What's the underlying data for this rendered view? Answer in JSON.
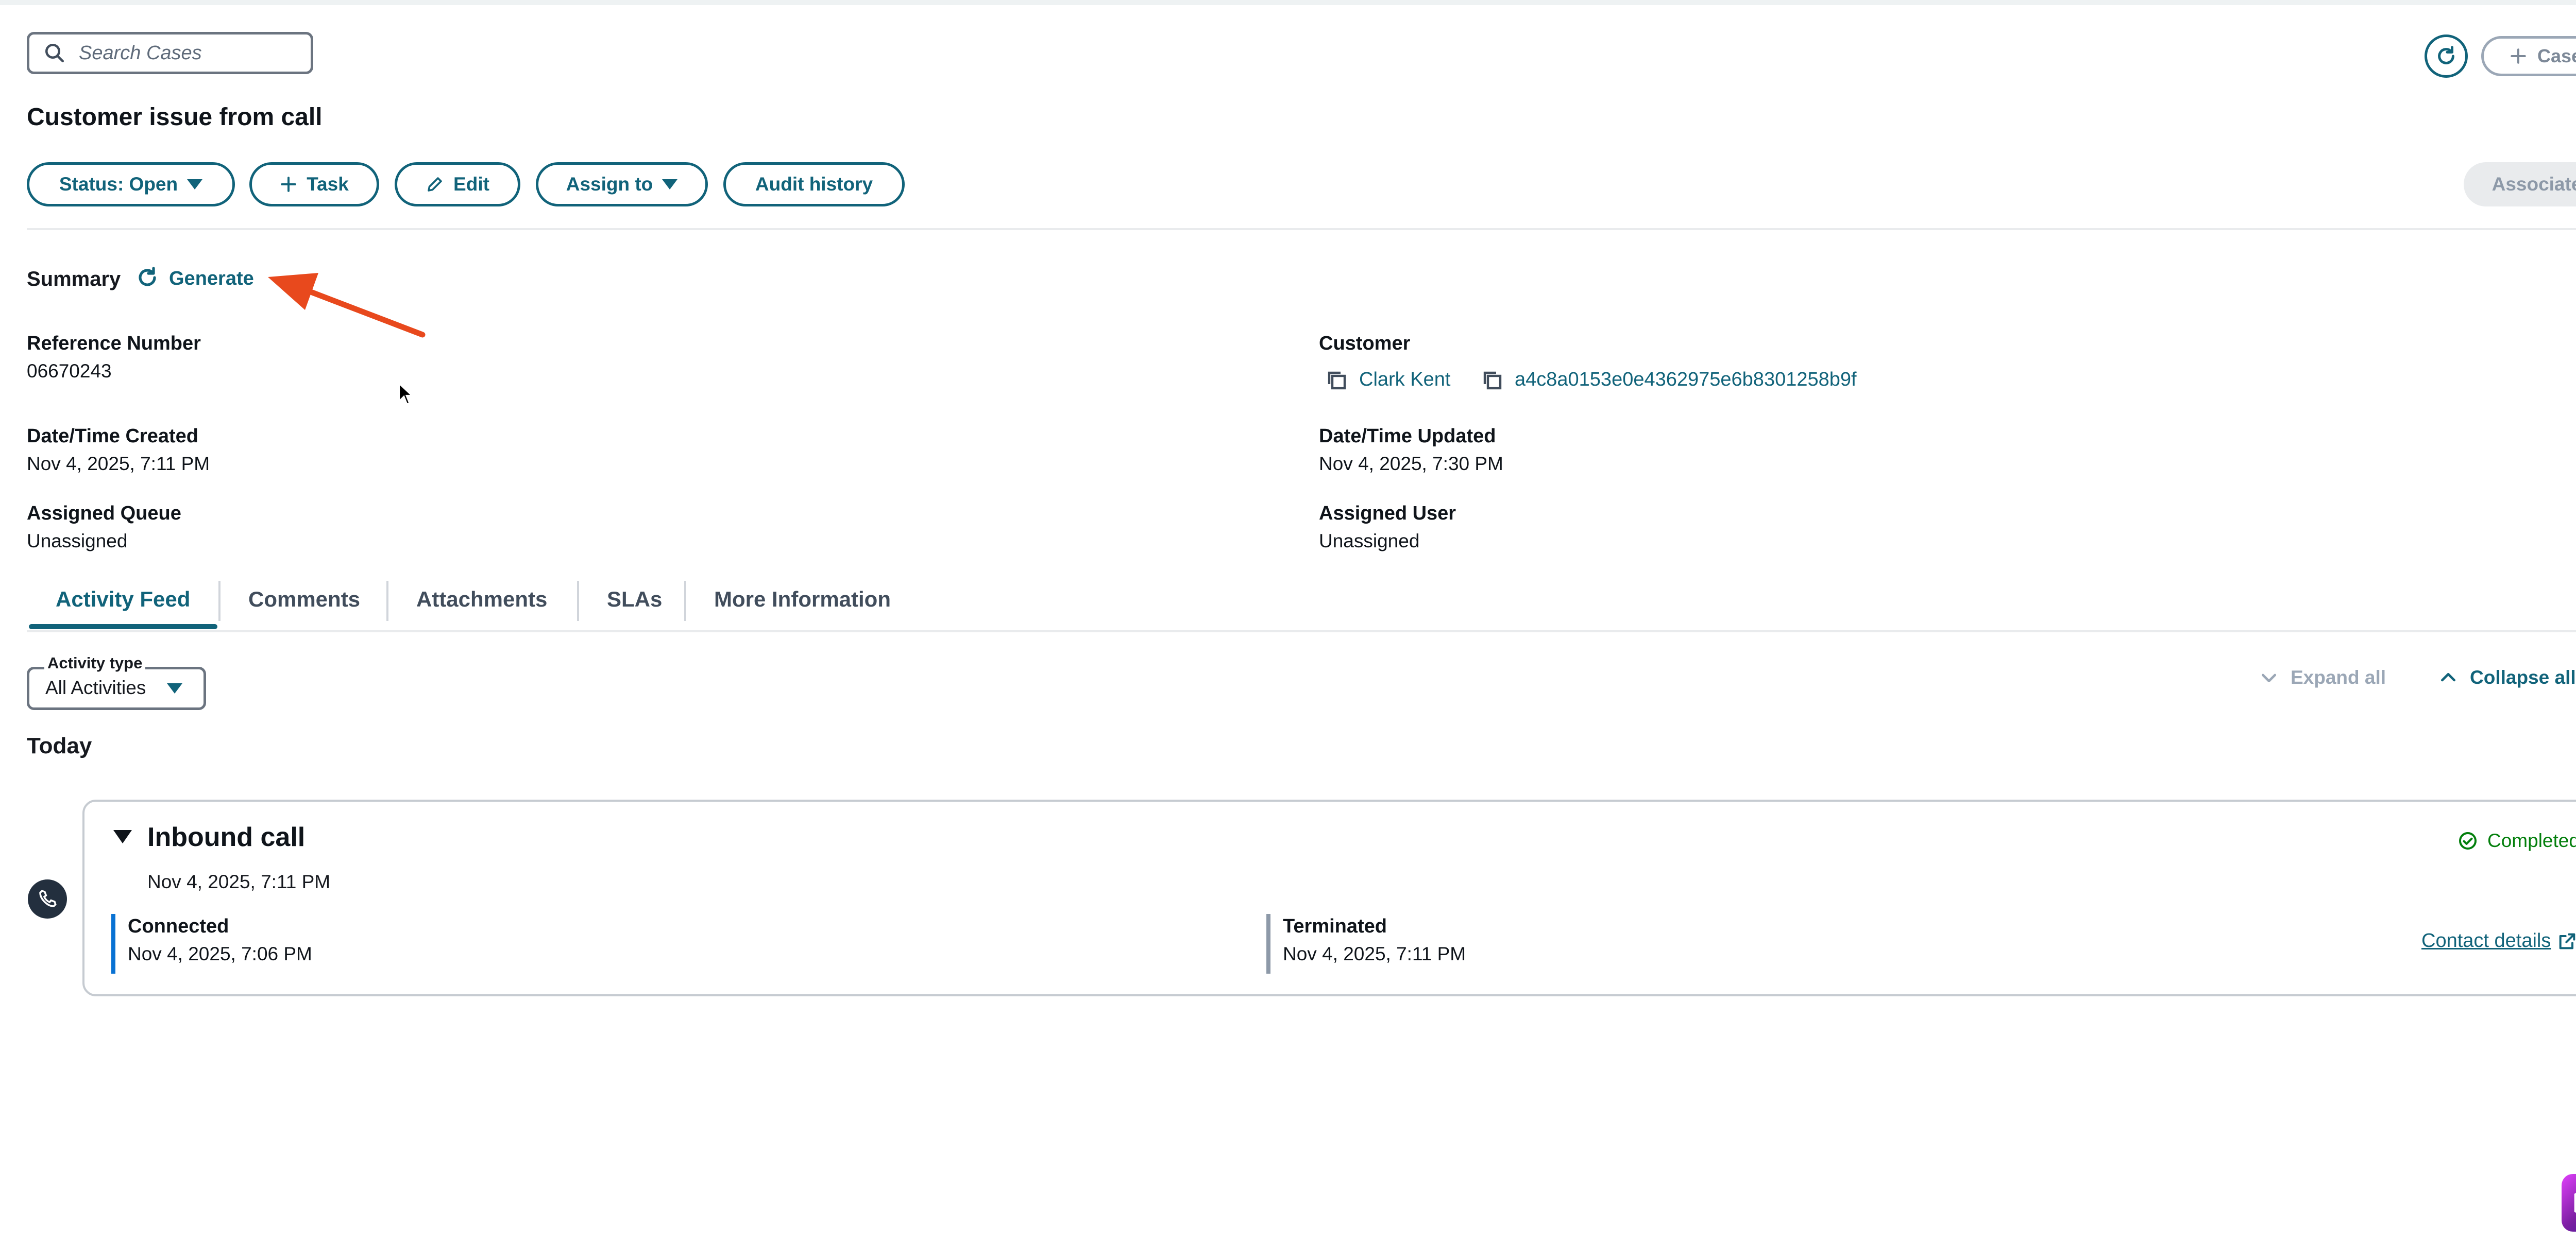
{
  "search": {
    "placeholder": "Search Cases"
  },
  "header": {
    "new_case_label": "Case"
  },
  "case": {
    "title": "Customer issue from call"
  },
  "toolbar": {
    "status_label": "Status: Open",
    "task_label": "Task",
    "edit_label": "Edit",
    "assign_label": "Assign to",
    "audit_label": "Audit history",
    "associate_label": "Associate"
  },
  "summary": {
    "label": "Summary",
    "generate_label": "Generate"
  },
  "fields": {
    "reference_number": {
      "label": "Reference Number",
      "value": "06670243"
    },
    "customer": {
      "label": "Customer",
      "name": "Clark Kent",
      "id": "a4c8a0153e0e4362975e6b8301258b9f"
    },
    "created": {
      "label": "Date/Time Created",
      "value": "Nov 4, 2025, 7:11 PM"
    },
    "updated": {
      "label": "Date/Time Updated",
      "value": "Nov 4, 2025, 7:30 PM"
    },
    "queue": {
      "label": "Assigned Queue",
      "value": "Unassigned"
    },
    "user": {
      "label": "Assigned User",
      "value": "Unassigned"
    }
  },
  "tabs": [
    {
      "label": "Activity Feed",
      "active": true
    },
    {
      "label": "Comments"
    },
    {
      "label": "Attachments"
    },
    {
      "label": "SLAs"
    },
    {
      "label": "More Information"
    }
  ],
  "feed": {
    "filter_label": "Activity type",
    "filter_value": "All Activities",
    "expand_all": "Expand all",
    "collapse_all": "Collapse all",
    "group_label": "Today"
  },
  "activity": {
    "title": "Inbound call",
    "date": "Nov 4, 2025, 7:11 PM",
    "status": "Completed",
    "connected_label": "Connected",
    "connected_time": "Nov 4, 2025, 7:06 PM",
    "terminated_label": "Terminated",
    "terminated_time": "Nov 4, 2025, 7:11 PM",
    "contact_link": "Contact details"
  },
  "colors": {
    "accent": "#11637a",
    "completed": "#037f0c",
    "annotation_arrow": "#e8491d",
    "connected_bar": "#0972d3"
  },
  "icons": [
    "search-icon",
    "refresh-icon",
    "plus-icon",
    "pencil-icon",
    "copy-icon",
    "chevron-down-icon",
    "chevron-up-icon",
    "phone-icon",
    "check-circle-icon",
    "external-link-icon"
  ]
}
